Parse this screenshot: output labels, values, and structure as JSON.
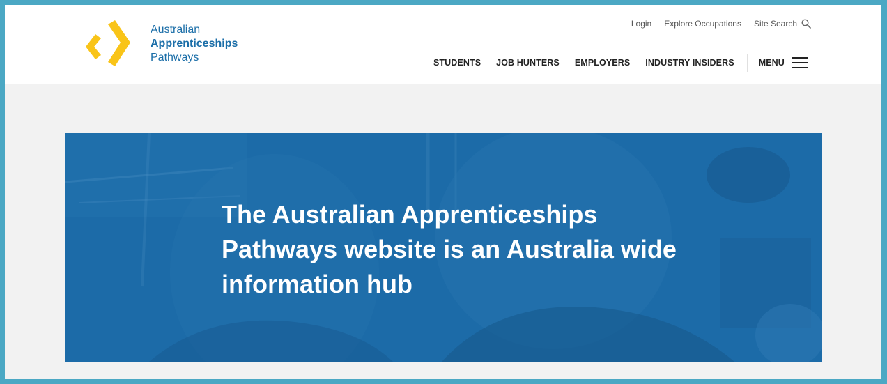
{
  "logo": {
    "line1": "Australian",
    "line2": "Apprenticeships",
    "line3": "Pathways",
    "chevron_color": "#f9c418"
  },
  "utility_nav": {
    "login": "Login",
    "explore": "Explore Occupations",
    "site_search": "Site Search",
    "search_icon": "search-icon"
  },
  "main_nav": {
    "items": [
      "STUDENTS",
      "JOB HUNTERS",
      "EMPLOYERS",
      "INDUSTRY INSIDERS"
    ],
    "menu_label": "MENU",
    "menu_icon": "hamburger-icon"
  },
  "hero": {
    "title": "The Australian Apprenticeships Pathways website is an Australia wide information hub",
    "overlay_color": "#1d6ba8"
  },
  "colors": {
    "frame_border": "#4ba8c4",
    "brand_blue": "#1b6ea8",
    "brand_yellow": "#f9c418"
  }
}
